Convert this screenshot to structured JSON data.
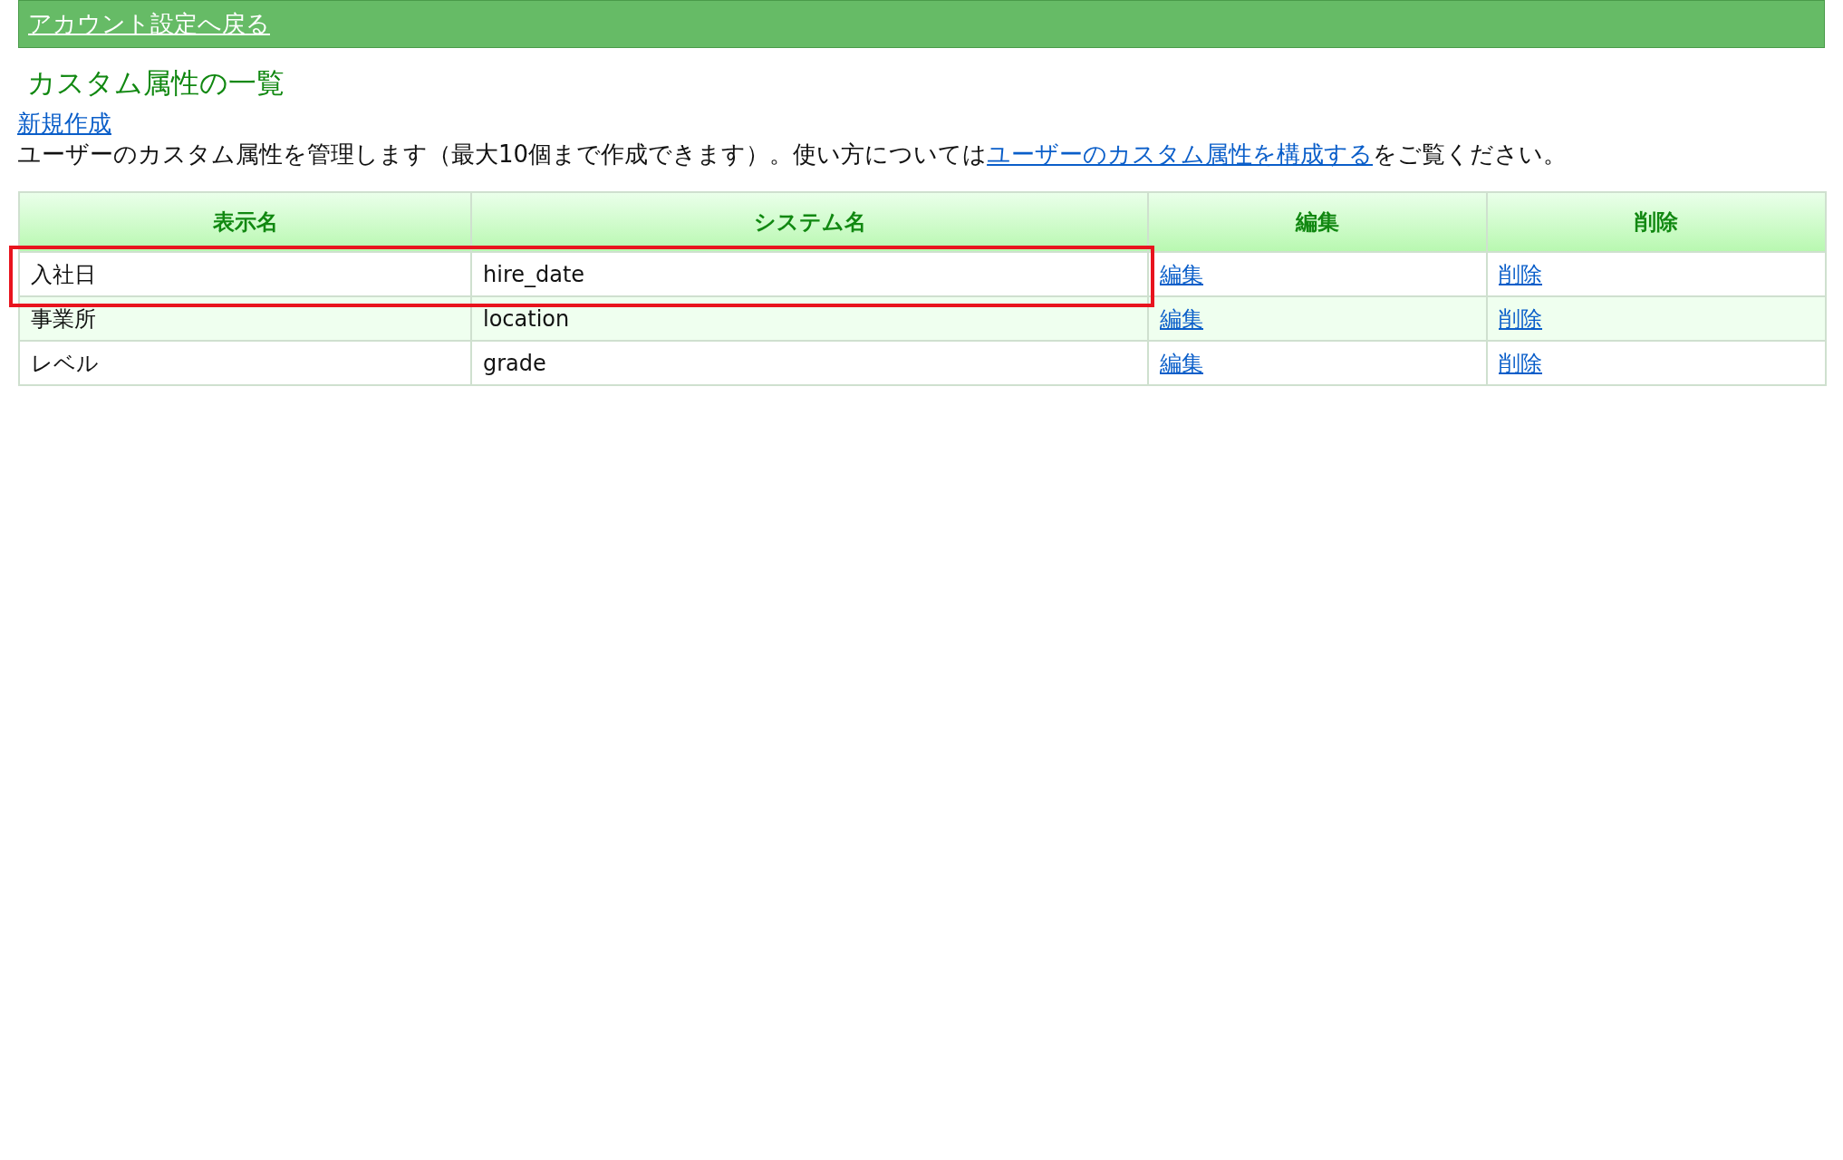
{
  "top_bar": {
    "back_link": "アカウント設定へ戻る"
  },
  "page_title": "カスタム属性の一覧",
  "create_link": "新規作成",
  "description": {
    "before": "ユーザーのカスタム属性を管理します（最大10個まで作成できます）。使い方については",
    "link": "ユーザーのカスタム属性を構成する",
    "after": "をご覧ください。"
  },
  "table": {
    "columns": [
      "表示名",
      "システム名",
      "編集",
      "削除"
    ],
    "rows": [
      {
        "display_name": "入社日",
        "system_name": "hire_date",
        "edit": "編集",
        "delete": "削除",
        "highlighted": true
      },
      {
        "display_name": "事業所",
        "system_name": "location",
        "edit": "編集",
        "delete": "削除",
        "highlighted": false
      },
      {
        "display_name": "レベル",
        "system_name": "grade",
        "edit": "編集",
        "delete": "削除",
        "highlighted": false
      }
    ]
  }
}
